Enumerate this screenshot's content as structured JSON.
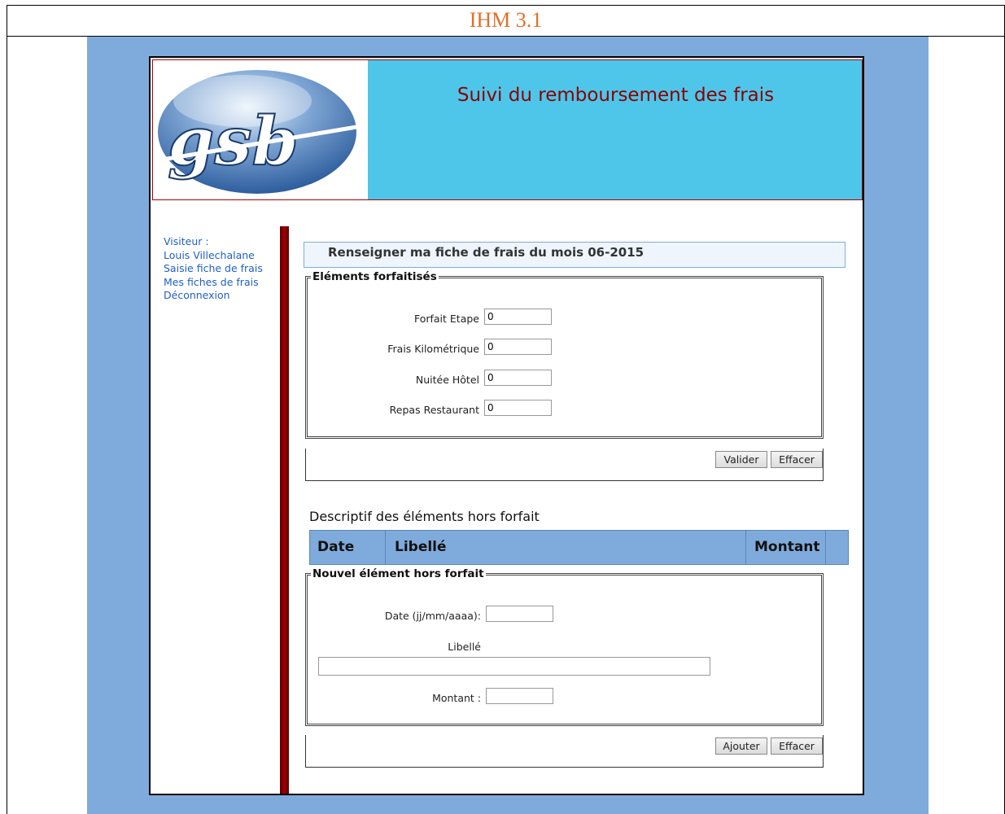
{
  "document": {
    "title": "IHM 3.1"
  },
  "header": {
    "logo_text": "gsb",
    "title": "Suivi du remboursement des frais"
  },
  "sidebar": {
    "visitor_label": "Visiteur :",
    "visitor_name": "Louis Villechalane",
    "items": [
      {
        "label": "Saisie fiche de frais"
      },
      {
        "label": "Mes fiches de frais"
      },
      {
        "label": "Déconnexion"
      }
    ]
  },
  "main": {
    "section_title": "Renseigner ma fiche de frais du mois 06-2015",
    "forfait": {
      "legend": "Eléments forfaitisés",
      "rows": [
        {
          "label": "Forfait Etape",
          "value": "0"
        },
        {
          "label": "Frais Kilométrique",
          "value": "0"
        },
        {
          "label": "Nuitée Hôtel",
          "value": "0"
        },
        {
          "label": "Repas Restaurant",
          "value": "0"
        }
      ],
      "validate_label": "Valider",
      "clear_label": "Effacer"
    },
    "hors_forfait": {
      "heading": "Descriptif des éléments hors forfait",
      "columns": [
        "Date",
        "Libellé",
        "Montant"
      ]
    },
    "nouvel_element": {
      "legend": "Nouvel élément hors forfait",
      "date_label": "Date (jj/mm/aaaa):",
      "date_value": "",
      "libelle_label": "Libellé",
      "libelle_value": "",
      "montant_label": "Montant :",
      "montant_value": "",
      "add_label": "Ajouter",
      "clear_label": "Effacer"
    }
  }
}
